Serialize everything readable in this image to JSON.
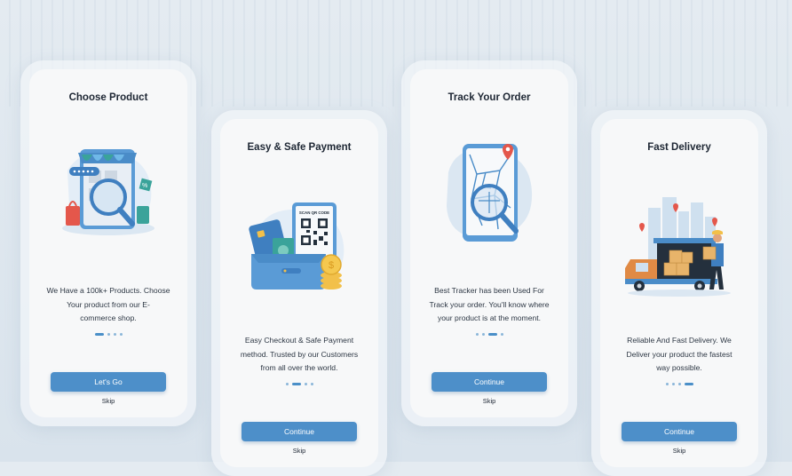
{
  "screens": [
    {
      "title": "Choose Product",
      "illustration": "shop-search-illustration",
      "description": [
        "We Have a 100k+ Products. Choose",
        "Your product from our E-",
        "commerce shop."
      ],
      "active_dot": 0,
      "button_label": "Let's Go",
      "skip_label": "Skip"
    },
    {
      "title": "Easy & Safe Payment",
      "illustration": "wallet-qr-illustration",
      "qr_label": "SCAN QR CODE",
      "description": [
        "Easy Checkout & Safe Payment",
        "method. Trusted by our Customers",
        "from all over the world."
      ],
      "active_dot": 1,
      "button_label": "Continue",
      "skip_label": "Skip"
    },
    {
      "title": "Track Your Order",
      "illustration": "map-tracking-illustration",
      "description": [
        "Best Tracker has been Used For",
        "Track your order. You'll know where",
        "your product is at the moment."
      ],
      "active_dot": 2,
      "button_label": "Continue",
      "skip_label": "Skip"
    },
    {
      "title": "Fast Delivery",
      "illustration": "delivery-truck-illustration",
      "description": [
        "Reliable And Fast Delivery. We",
        "Deliver your product the fastest",
        "way possible."
      ],
      "active_dot": 3,
      "button_label": "Continue",
      "skip_label": "Skip"
    }
  ],
  "colors": {
    "accent": "#4d8fc9",
    "dot": "#8bb6d9",
    "background": "#e2e9ef"
  }
}
